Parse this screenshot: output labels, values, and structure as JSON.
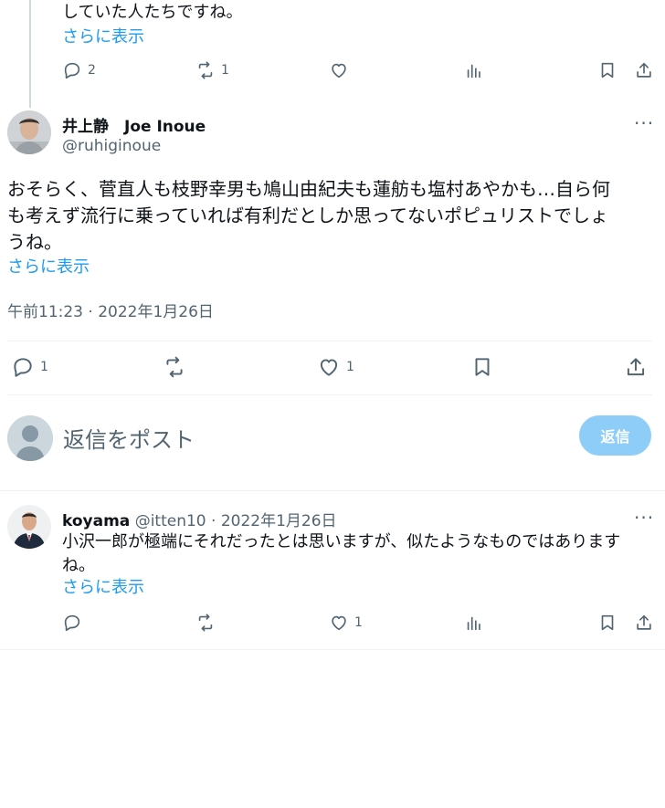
{
  "tweet1": {
    "text_tail": "していた人たちですね。",
    "show_more": "さらに表示",
    "replies": "2",
    "retweets": "1"
  },
  "main_tweet": {
    "name": "井上静　Joe Inoue",
    "handle": "@ruhiginoue",
    "text_line1": "おそらく、菅直人も枝野幸男も鳩山由紀夫も蓮舫も塩村あやかも…自ら何",
    "text_line2": "も考えず流行に乗っていれば有利だとしか思ってないポピュリストでしょ",
    "text_line3": "うね。",
    "show_more": "さらに表示",
    "timestamp": "午前11:23 · 2022年1月26日",
    "replies": "1",
    "likes": "1"
  },
  "composer": {
    "placeholder": "返信をポスト",
    "button": "返信"
  },
  "reply": {
    "name": "koyama",
    "handle_date": "@itten10 · 2022年1月26日",
    "text_line1": "小沢一郎が極端にそれだったとは思いますが、似たようなものではありま",
    "text_line2": "す",
    "text_line3": "ね。",
    "show_more": "さらに表示",
    "likes": "1"
  }
}
